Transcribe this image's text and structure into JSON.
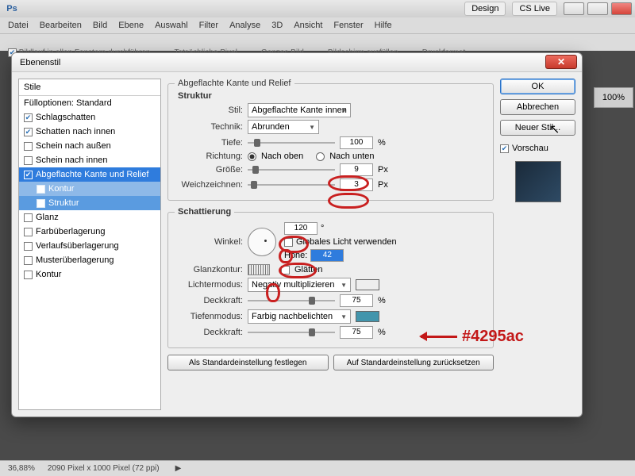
{
  "app": {
    "suite": "Ps",
    "cslive": "CS Live",
    "design": "Design"
  },
  "menu": [
    "Datei",
    "Bearbeiten",
    "Bild",
    "Ebene",
    "Auswahl",
    "Filter",
    "Analyse",
    "3D",
    "Ansicht",
    "Fenster",
    "Hilfe"
  ],
  "toolbar_opts": [
    "Bildlauf in allen Fenstern durchführen",
    "Tatsächliche Pixel",
    "Ganzes Bild",
    "Bildschirm ausfüllen",
    "Druckformat"
  ],
  "dialog": {
    "title": "Ebenenstil",
    "sidebar_header": "Stile",
    "sidebar": [
      {
        "label": "Fülloptionen: Standard",
        "checked": false,
        "nochk": true
      },
      {
        "label": "Schlagschatten",
        "checked": true
      },
      {
        "label": "Schatten nach innen",
        "checked": true
      },
      {
        "label": "Schein nach außen",
        "checked": false
      },
      {
        "label": "Schein nach innen",
        "checked": false
      },
      {
        "label": "Abgeflachte Kante und Relief",
        "checked": true,
        "selected": true
      },
      {
        "label": "Kontur",
        "sub": true
      },
      {
        "label": "Struktur",
        "sub": true,
        "subsel": true
      },
      {
        "label": "Glanz",
        "checked": false
      },
      {
        "label": "Farbüberlagerung",
        "checked": false
      },
      {
        "label": "Verlaufsüberlagerung",
        "checked": false
      },
      {
        "label": "Musterüberlagerung",
        "checked": false
      },
      {
        "label": "Kontur",
        "checked": false
      }
    ],
    "group_main": "Abgeflachte Kante und Relief",
    "group_struct": "Struktur",
    "labels": {
      "stil": "Stil:",
      "stil_val": "Abgeflachte Kante innen",
      "technik": "Technik:",
      "technik_val": "Abrunden",
      "tiefe": "Tiefe:",
      "tiefe_val": "100",
      "pct": "%",
      "richtung": "Richtung:",
      "oben": "Nach oben",
      "unten": "Nach unten",
      "groesse": "Größe:",
      "groesse_val": "9",
      "px": "Px",
      "weich": "Weichzeichnen:",
      "weich_val": "3"
    },
    "group_shade": "Schattierung",
    "shade": {
      "winkel": "Winkel:",
      "winkel_val": "120",
      "deg": "°",
      "global": "Globales Licht verwenden",
      "global_on": false,
      "hoehe": "Höhe:",
      "hoehe_val": "42",
      "glanzk": "Glanzkontur:",
      "glaetten": "Glätten",
      "licht": "Lichtermodus:",
      "licht_val": "Negativ multiplizieren",
      "licht_color": "#ffffff",
      "deck": "Deckkraft:",
      "deck_val": "75",
      "tiefm": "Tiefenmodus:",
      "tiefm_val": "Farbig nachbelichten",
      "tiefm_color": "#4295ac",
      "deck2_val": "75"
    },
    "bottom": {
      "save": "Als Standardeinstellung festlegen",
      "reset": "Auf Standardeinstellung zurücksetzen"
    },
    "buttons": {
      "ok": "OK",
      "cancel": "Abbrechen",
      "new": "Neuer Stil...",
      "preview": "Vorschau"
    }
  },
  "annotation": "#4295ac",
  "status": {
    "zoom": "36,88%",
    "doc": "2090 Pixel x 1000 Pixel (72 ppi)"
  },
  "panel_pct": "100%"
}
